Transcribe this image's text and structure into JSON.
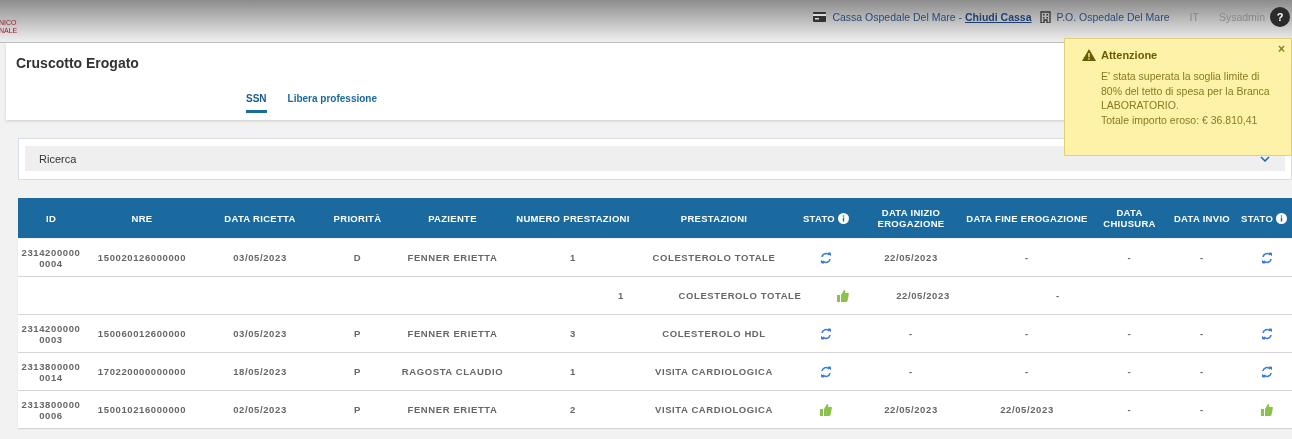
{
  "top_bar": {
    "logo_lines": [
      "NICO",
      "NALE"
    ],
    "cash_desk": "Cassa Ospedale Del Mare -",
    "close_cash_link": "Chiudi Cassa",
    "facility": "P.O. Ospedale Del Mare",
    "language": "IT",
    "user": "Sysadmin",
    "help": "?"
  },
  "page_title": "Cruscotto Erogato",
  "tabs": [
    {
      "label": "SSN",
      "selected": true
    },
    {
      "label": "Libera professione",
      "selected": false
    }
  ],
  "search_panel": {
    "label": "Ricerca",
    "expanded": false
  },
  "table": {
    "columns": [
      {
        "label": "ID",
        "info": false
      },
      {
        "label": "NRE",
        "info": false
      },
      {
        "label": "DATA RICETTA",
        "info": false
      },
      {
        "label": "PRIORITÀ",
        "info": false
      },
      {
        "label": "PAZIENTE",
        "info": false
      },
      {
        "label": "NUMERO PRESTAZIONI",
        "info": false
      },
      {
        "label": "PRESTAZIONI",
        "info": false
      },
      {
        "label": "STATO",
        "info": true
      },
      {
        "label": "DATA INIZIO EROGAZIONE",
        "info": false
      },
      {
        "label": "DATA FINE EROGAZIONE",
        "info": false
      },
      {
        "label": "DATA CHIUSURA",
        "info": false
      },
      {
        "label": "DATA INVIO",
        "info": false
      },
      {
        "label": "STATO",
        "info": true
      }
    ],
    "rows": [
      {
        "kind": "main",
        "id": "2314200000 0004",
        "nre": "150020126000000",
        "data_ricetta": "03/05/2023",
        "priorita": "D",
        "paziente": "FENNER ERIETTA",
        "numero": "1",
        "prestazioni": "COLESTEROLO TOTALE",
        "completed": false,
        "data_inizio": "22/05/2023",
        "data_fine": "-",
        "data_chiusura": "-",
        "data_invio": "-",
        "completed_2": false
      },
      {
        "kind": "sub",
        "numero": "1",
        "prestazioni": "COLESTEROLO TOTALE",
        "completed": true,
        "data_inizio": "22/05/2023",
        "data_fine": "-"
      },
      {
        "kind": "main",
        "id": "2314200000 0003",
        "nre": "150060012600000",
        "data_ricetta": "03/05/2023",
        "priorita": "P",
        "paziente": "FENNER ERIETTA",
        "numero": "3",
        "prestazioni": "COLESTEROLO HDL",
        "completed": false,
        "data_inizio": "-",
        "data_fine": "-",
        "data_chiusura": "-",
        "data_invio": "-",
        "completed_2": false
      },
      {
        "kind": "main",
        "id": "2313800000 0014",
        "nre": "170220000000000",
        "data_ricetta": "18/05/2023",
        "priorita": "P",
        "paziente": "RAGOSTA CLAUDIO",
        "numero": "1",
        "prestazioni": "VISITA CARDIOLOGICA",
        "completed": false,
        "data_inizio": "-",
        "data_fine": "-",
        "data_chiusura": "-",
        "data_invio": "-",
        "completed_2": false
      },
      {
        "kind": "main",
        "id": "2313800000 0006",
        "nre": "150010216000000",
        "data_ricetta": "02/05/2023",
        "priorita": "P",
        "paziente": "FENNER ERIETTA",
        "numero": "2",
        "prestazioni": "VISITA CARDIOLOGICA",
        "completed": true,
        "data_inizio": "22/05/2023",
        "data_fine": "22/05/2023",
        "data_chiusura": "-",
        "data_invio": "-",
        "completed_2": true
      }
    ]
  },
  "toast": {
    "title": "Attenzione",
    "close": "×",
    "message": "E' stata superata la soglia limite di 80% del tetto di spesa per la Branca LABORATORIO.",
    "total": "Totale importo eroso: € 36.810,41"
  }
}
